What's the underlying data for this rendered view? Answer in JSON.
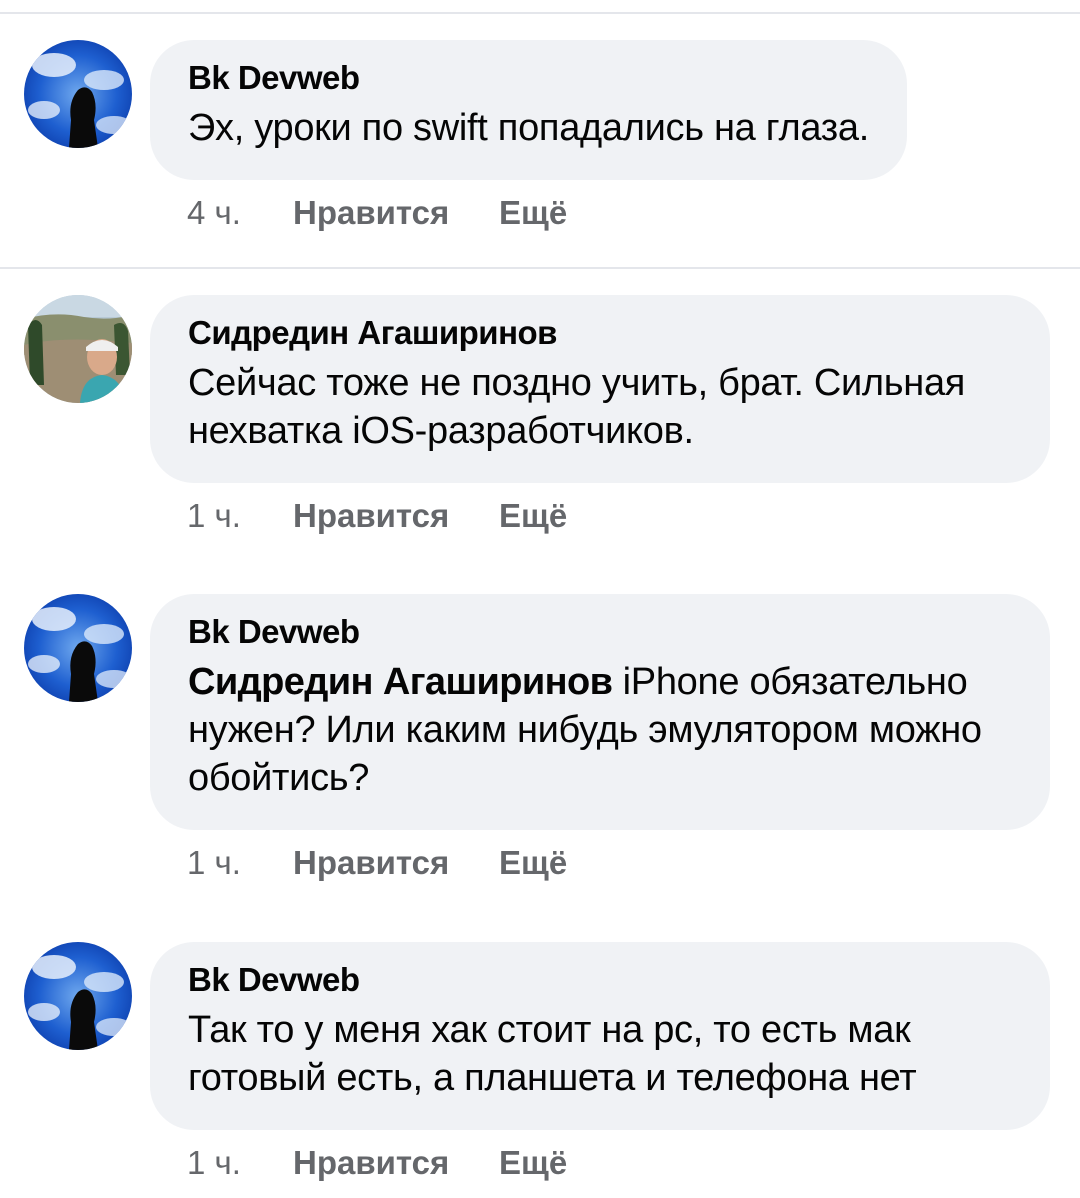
{
  "comments": [
    {
      "author": "Bk Devweb",
      "mention": "",
      "text": "Эх, уроки по swift попадались на глаза.",
      "time": "4 ч.",
      "like_label": "Нравится",
      "more_label": "Ещё",
      "avatar": "blue-sky-silhouette"
    },
    {
      "author": "Сидредин Агаширинов",
      "mention": "",
      "text": "Сейчас тоже не поздно учить, брат. Сильная нехватка iOS-разработчиков.",
      "time": "1 ч.",
      "like_label": "Нравится",
      "more_label": "Ещё",
      "avatar": "man-in-cap-outdoor"
    },
    {
      "author": "Bk Devweb",
      "mention": "Сидредин Агаширинов",
      "text": " iPhone обязательно нужен? Или каким нибудь эмулятором можно обойтись?",
      "time": "1 ч.",
      "like_label": "Нравится",
      "more_label": "Ещё",
      "avatar": "blue-sky-silhouette"
    },
    {
      "author": "Bk Devweb",
      "mention": "",
      "text": "Так то у меня хак стоит на pc, то есть мак готовый есть, а планшета и телефона нет",
      "time": "1 ч.",
      "like_label": "Нравится",
      "more_label": "Ещё",
      "avatar": "blue-sky-silhouette"
    }
  ],
  "colors": {
    "bubble": "#f0f2f5",
    "text": "#050505",
    "meta": "#65676b",
    "divider": "#e4e6eb"
  }
}
